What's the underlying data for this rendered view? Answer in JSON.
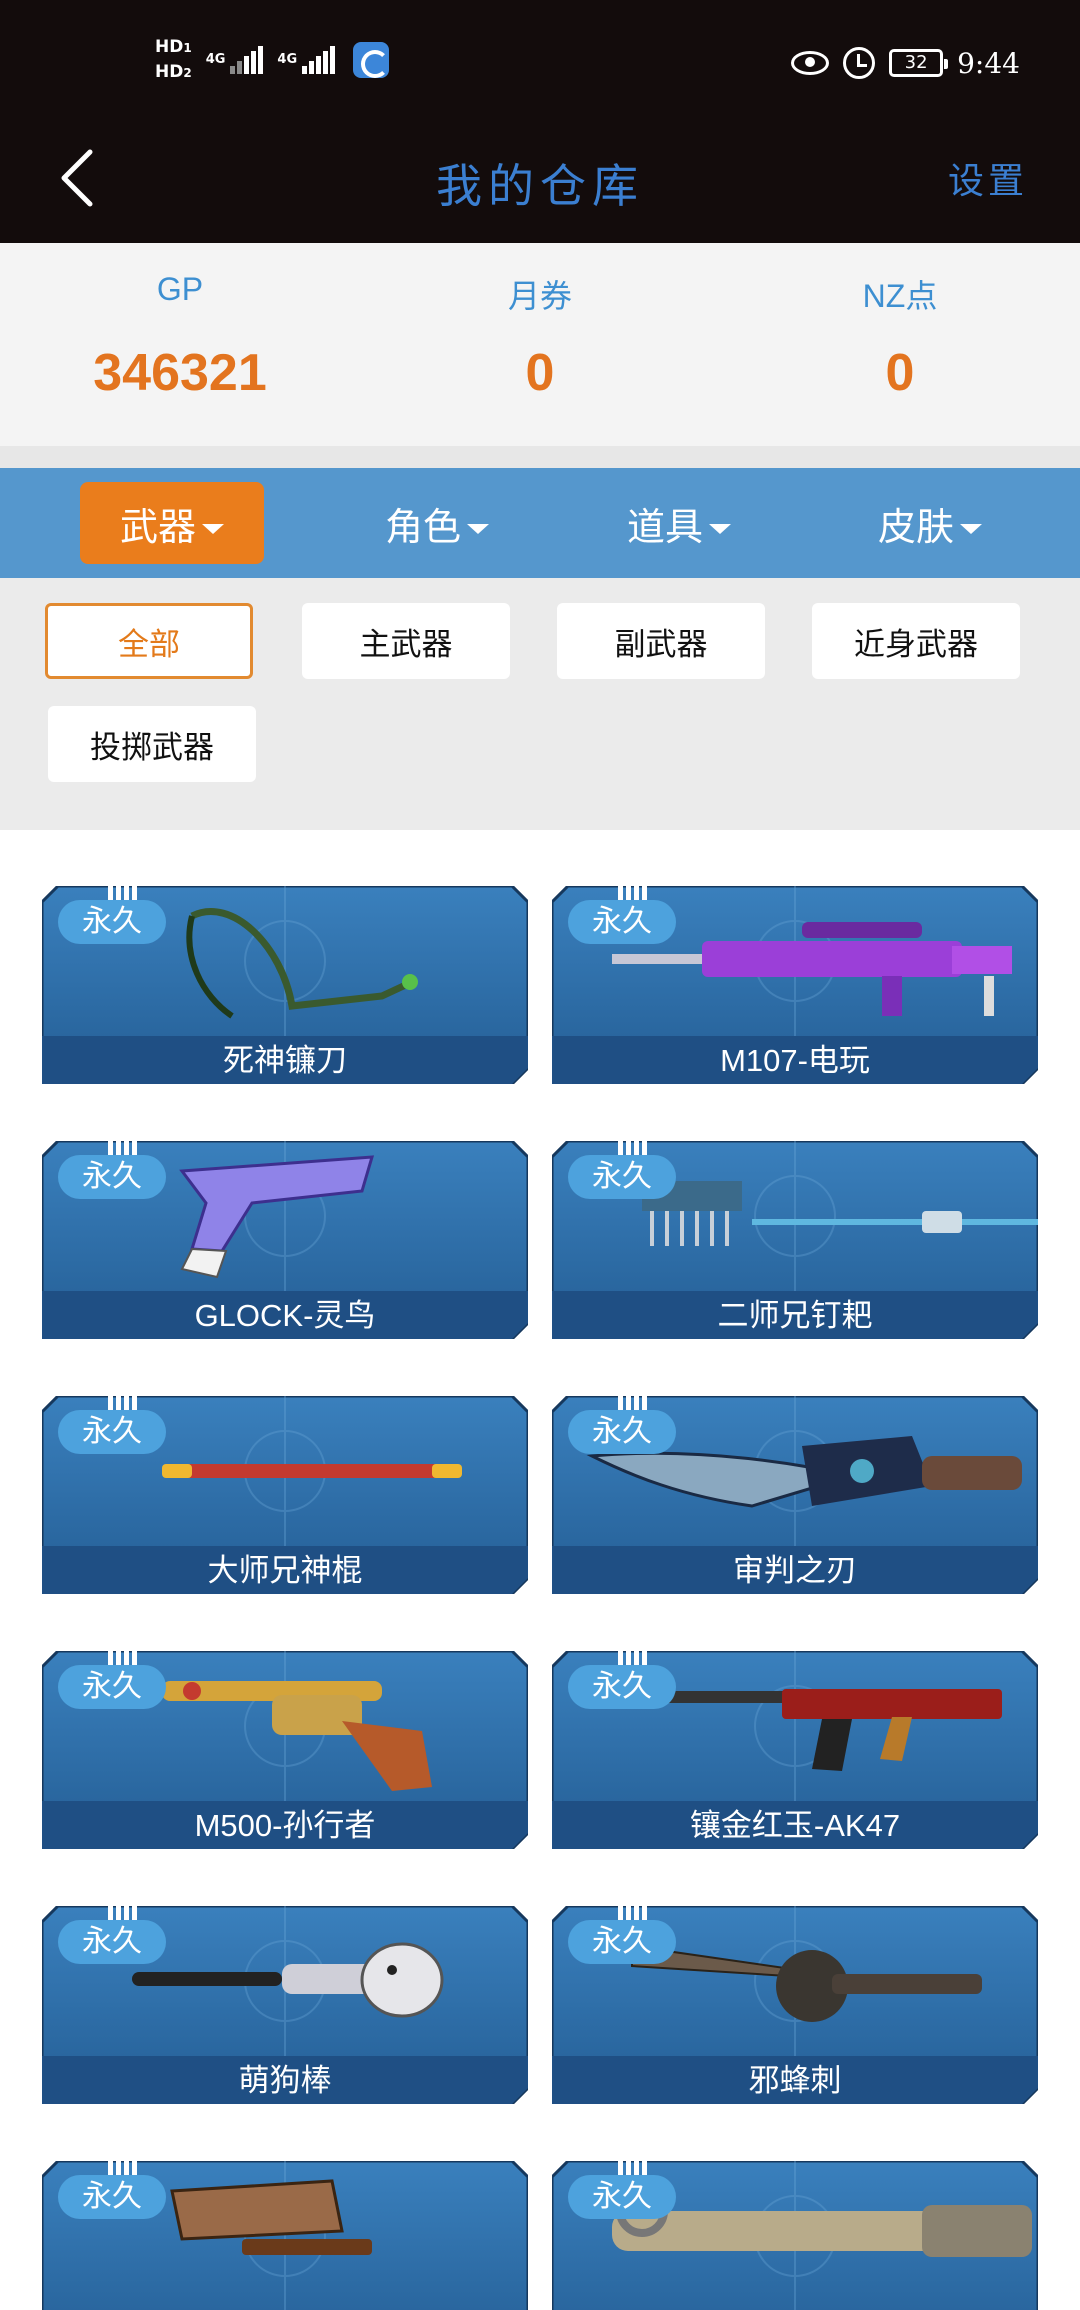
{
  "status_bar": {
    "hd1": "HD",
    "hd1_sub": "1",
    "hd2": "HD",
    "hd2_sub": "2",
    "net1": "4G",
    "net2": "4G",
    "battery": "32",
    "time": "9:44"
  },
  "header": {
    "title": "我的仓库",
    "settings_label": "设置"
  },
  "currency": [
    {
      "label": "GP",
      "value": "346321"
    },
    {
      "label": "月券",
      "value": "0"
    },
    {
      "label": "NZ点",
      "value": "0"
    }
  ],
  "tabs": [
    {
      "label": "武器",
      "active": true
    },
    {
      "label": "角色",
      "active": false
    },
    {
      "label": "道具",
      "active": false
    },
    {
      "label": "皮肤",
      "active": false
    }
  ],
  "filters": [
    {
      "label": "全部",
      "active": true
    },
    {
      "label": "主武器",
      "active": false
    },
    {
      "label": "副武器",
      "active": false
    },
    {
      "label": "近身武器",
      "active": false
    },
    {
      "label": "投掷武器",
      "active": false
    }
  ],
  "items": [
    {
      "badge": "永久",
      "name": "死神镰刀",
      "icon": "scythe-icon"
    },
    {
      "badge": "永久",
      "name": "M107-电玩",
      "icon": "sniper-rifle-icon"
    },
    {
      "badge": "永久",
      "name": "GLOCK-灵鸟",
      "icon": "pistol-icon"
    },
    {
      "badge": "永久",
      "name": "二师兄钉耙",
      "icon": "rake-icon"
    },
    {
      "badge": "永久",
      "name": "大师兄神棍",
      "icon": "staff-icon"
    },
    {
      "badge": "永久",
      "name": "审判之刃",
      "icon": "blade-icon"
    },
    {
      "badge": "永久",
      "name": "M500-孙行者",
      "icon": "revolver-icon"
    },
    {
      "badge": "永久",
      "name": "镶金红玉-AK47",
      "icon": "assault-rifle-icon"
    },
    {
      "badge": "永久",
      "name": "萌狗棒",
      "icon": "dog-bat-icon"
    },
    {
      "badge": "永久",
      "name": "邪蜂刺",
      "icon": "spiked-sword-icon"
    },
    {
      "badge": "永久",
      "name": "",
      "icon": "cleaver-icon"
    },
    {
      "badge": "永久",
      "name": "",
      "icon": "pipe-icon"
    }
  ],
  "colors": {
    "header_bg": "#130c0c",
    "title_blue": "#3b7fd1",
    "accent_orange": "#ea7d1c",
    "tab_bar_blue": "#5597cd",
    "card_blue": "#2f6ea8",
    "badge_blue": "#4da2dd"
  }
}
